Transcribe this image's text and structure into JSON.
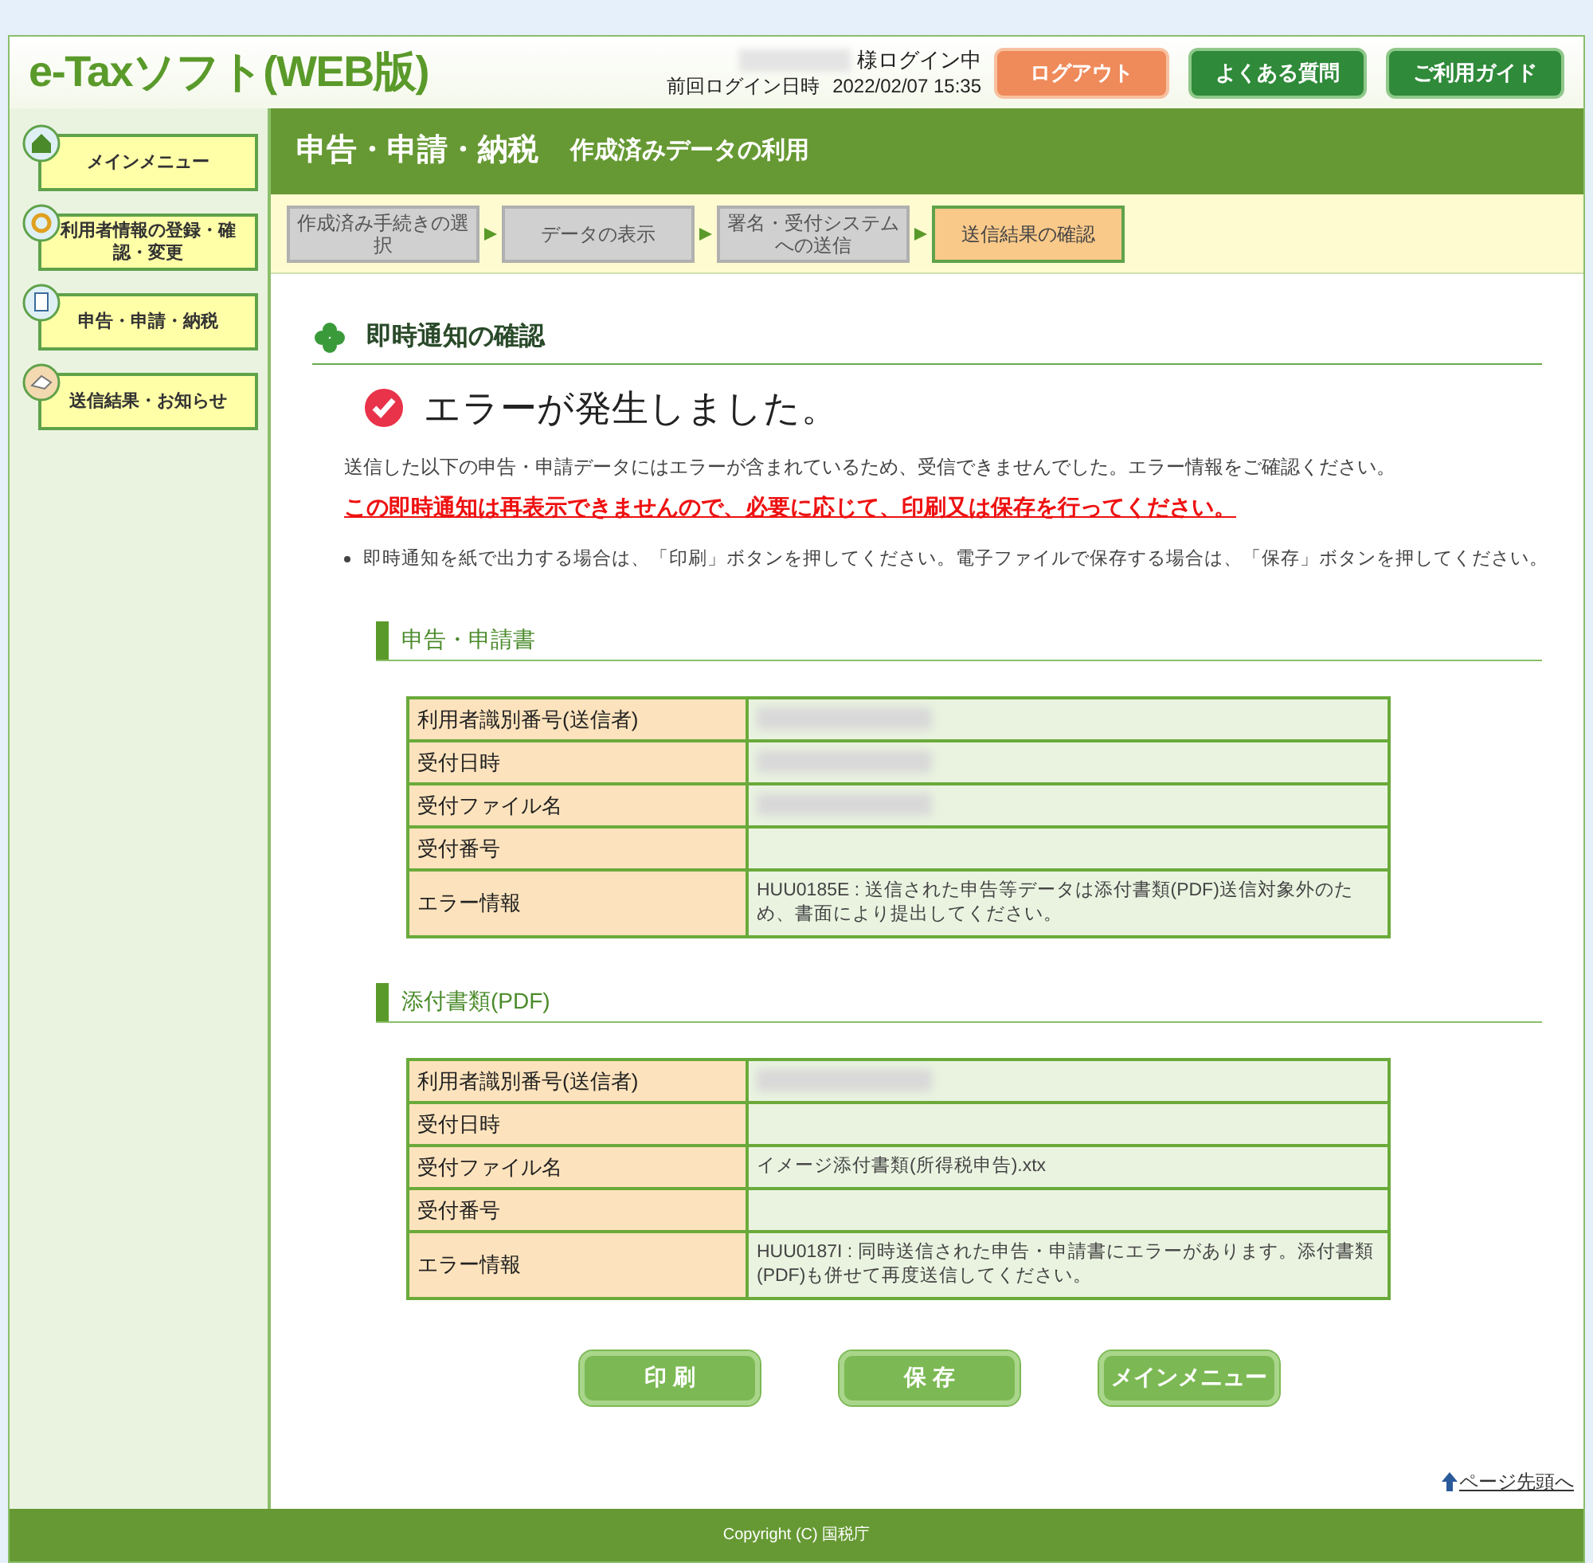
{
  "header": {
    "logo": "e-Taxソフト(WEB版)",
    "login_status": "様ログイン中",
    "login_name_redacted": true,
    "last_login_label": "前回ログイン日時",
    "last_login_value": "2022/02/07 15:35",
    "buttons": [
      {
        "label": "ログアウト",
        "kind": "orange"
      },
      {
        "label": "よくある質問",
        "kind": "green"
      },
      {
        "label": "ご利用ガイド",
        "kind": "green"
      }
    ]
  },
  "sidebar": {
    "items": [
      {
        "label": "メインメニュー",
        "kind": "home"
      },
      {
        "label": "利用者情報の登録・確認・変更",
        "kind": "ring"
      },
      {
        "label": "申告・申請・納税",
        "kind": "doc"
      },
      {
        "label": "送信結果・お知らせ",
        "kind": "mail"
      }
    ]
  },
  "title_bar": {
    "title": "申告・申請・納税",
    "subtitle": "作成済みデータの利用"
  },
  "steps": [
    {
      "label": "作成済み手続きの選択",
      "selected": false
    },
    {
      "label": "データの表示",
      "selected": false
    },
    {
      "label": "署名・受付システムへの送信",
      "selected": false
    },
    {
      "label": "送信結果の確認",
      "selected": true
    }
  ],
  "section_title": "即時通知の確認",
  "status_heading": "エラーが発生しました。",
  "message": "送信した以下の申告・申請データにはエラーが含まれているため、受信できませんでした。エラー情報をご確認ください。",
  "warning": "この即時通知は再表示できませんので、必要に応じて、印刷又は保存を行ってください。",
  "bullets": [
    "即時通知を紙で出力する場合は、「印刷」ボタンを押してください。電子ファイルで保存する場合は、「保存」ボタンを押してください。"
  ],
  "tables": [
    {
      "title": "申告・申請書",
      "rows": [
        {
          "label": "利用者識別番号(送信者)",
          "redacted": true
        },
        {
          "label": "受付日時",
          "redacted": true
        },
        {
          "label": "受付ファイル名",
          "redacted": true
        },
        {
          "label": "受付番号",
          "redacted": false
        },
        {
          "label": "エラー情報",
          "value": "HUU0185E : 送信された申告等データは添付書類(PDF)送信対象外のため、書面により提出してください。",
          "redacted": false
        }
      ]
    },
    {
      "title": "添付書類(PDF)",
      "rows": [
        {
          "label": "利用者識別番号(送信者)",
          "redacted": true
        },
        {
          "label": "受付日時",
          "redacted": false
        },
        {
          "label": "受付ファイル名",
          "value": "イメージ添付書類(所得税申告).xtx",
          "redacted": false
        },
        {
          "label": "受付番号",
          "redacted": false
        },
        {
          "label": "エラー情報",
          "value": "HUU0187I : 同時送信された申告・申請書にエラーがあります。添付書類(PDF)も併せて再度送信してください。",
          "redacted": false
        }
      ]
    }
  ],
  "actions": [
    "印 刷",
    "保 存",
    "メインメニュー"
  ],
  "page_top_link": "ページ先頭へ",
  "footer": "Copyright (C) 国税庁"
}
